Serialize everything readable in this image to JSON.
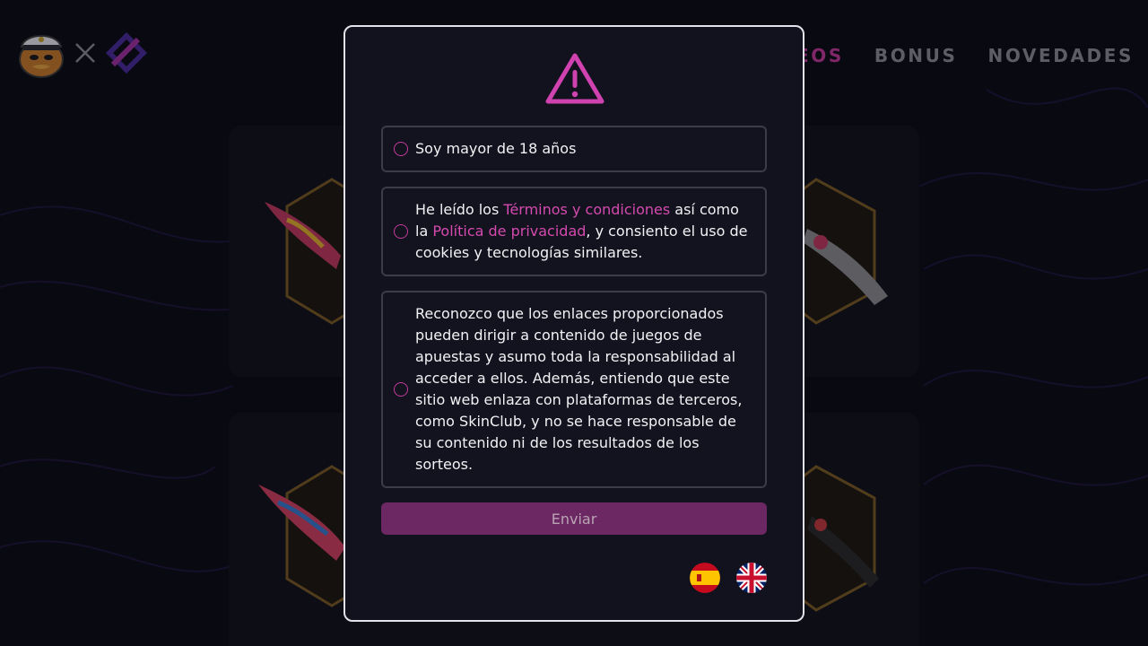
{
  "nav": {
    "items": [
      {
        "label": "TEOS",
        "active": true
      },
      {
        "label": "BONUS",
        "active": false
      },
      {
        "label": "NOVEDADES",
        "active": false
      }
    ]
  },
  "modal": {
    "option1": "Soy mayor de 18 años",
    "option2": {
      "prefix": "He leído los ",
      "terms_link": "Términos y condiciones",
      "middle": " así como la ",
      "privacy_link": "Política de privacidad",
      "suffix": ", y consiento el uso de cookies y tecnologías similares."
    },
    "option3": "Reconozco que los enlaces proporcionados pueden dirigir a contenido de juegos de apuestas y asumo toda la responsabilidad al acceder a ellos. Además, entiendo que este sitio web enlaza con plataformas de terceros, como SkinClub, y no se hace responsable de su contenido ni de los resultados de los sorteos.",
    "submit_label": "Enviar"
  },
  "colors": {
    "accent": "#c13a9c",
    "background": "#0c0c15",
    "modal_bg": "#12121e"
  },
  "icons": [
    "warning-icon",
    "spain-flag-icon",
    "uk-flag-icon",
    "close-x-icon"
  ]
}
